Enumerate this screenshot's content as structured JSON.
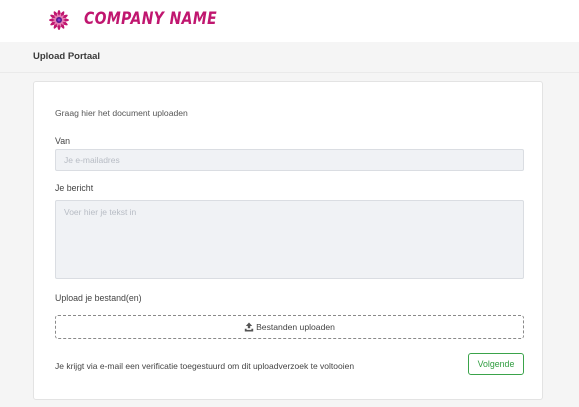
{
  "brand": {
    "name": "COMPANY NAME",
    "logo_icon": "flower-logo-icon",
    "color": "#c0166f"
  },
  "subbar": {
    "title": "Upload Portaal"
  },
  "form": {
    "intro": "Graag hier het document uploaden",
    "from_label": "Van",
    "email_placeholder": "Je e-mailadres",
    "email_value": "",
    "message_label": "Je bericht",
    "message_placeholder": "Voer hier je tekst in",
    "message_value": "",
    "upload_label": "Upload je bestand(en)",
    "upload_button_label": "Bestanden uploaden",
    "upload_icon": "upload-icon",
    "verification_note": "Je krijgt via e-mail een verificatie toegestuurd om dit uploadverzoek te voltooien",
    "next_button_label": "Volgende",
    "next_button_color": "#2f9c3f"
  }
}
